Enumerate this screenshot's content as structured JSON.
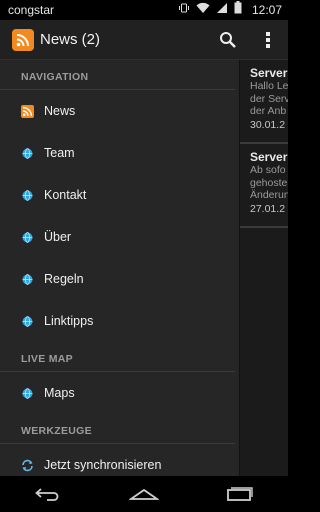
{
  "status_bar": {
    "carrier": "congstar",
    "time": "12:07"
  },
  "action_bar": {
    "title": "News (2)"
  },
  "drawer": {
    "sections": [
      {
        "header": "NAVIGATION",
        "items": [
          {
            "label": "News",
            "icon": "rss-icon"
          },
          {
            "label": "Team",
            "icon": "globe-icon"
          },
          {
            "label": "Kontakt",
            "icon": "globe-icon"
          },
          {
            "label": "Über",
            "icon": "globe-icon"
          },
          {
            "label": "Regeln",
            "icon": "globe-icon"
          },
          {
            "label": "Linktipps",
            "icon": "globe-icon"
          }
        ]
      },
      {
        "header": "LIVE MAP",
        "items": [
          {
            "label": "Maps",
            "icon": "globe-icon"
          }
        ]
      },
      {
        "header": "WERKZEUGE",
        "items": [
          {
            "label": "Jetzt synchronisieren",
            "icon": "sync-icon"
          }
        ]
      }
    ]
  },
  "articles": [
    {
      "title": "Server",
      "lines": [
        "Hallo Le",
        "der Serv",
        "der Anb"
      ],
      "date": "30.01.2"
    },
    {
      "title": "Server",
      "lines": [
        "Ab sofo",
        "gehoste",
        "Änderun"
      ],
      "date": "27.01.2"
    }
  ],
  "colors": {
    "accent_orange": "#f28a1f",
    "globe_blue": "#2fa6e0",
    "drawer_bg": "#262626",
    "actionbar_bg": "#212121"
  }
}
